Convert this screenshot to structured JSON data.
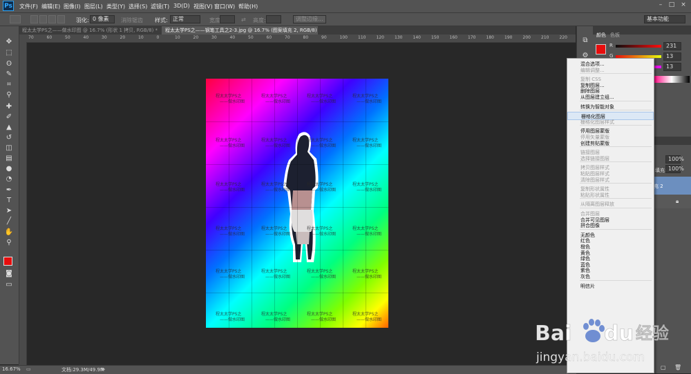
{
  "app": {
    "logo": "Ps"
  },
  "menu": [
    "文件(F)",
    "编辑(E)",
    "图像(I)",
    "图层(L)",
    "类型(Y)",
    "选择(S)",
    "滤镜(T)",
    "3D(D)",
    "视图(V)",
    "窗口(W)",
    "帮助(H)"
  ],
  "window_controls": [
    "–",
    "□",
    "×"
  ],
  "options": {
    "feather_label": "羽化:",
    "feather_value": "0 像素",
    "antialias": "消除锯齿",
    "style_label": "样式:",
    "style_value": "正常",
    "width_label": "宽度:",
    "height_label": "高度:",
    "refine_edge": "调整边缘...",
    "workspace": "基本功能"
  },
  "tabs": [
    {
      "label": "程太太学PS之——做水印图 @ 16.7% (形状 1 拷贝, RGB/8) *",
      "active": false
    },
    {
      "label": "程太太学PS之——钢笔工具之2-3.jpg @ 16.7% (图案填充 2, RGB/8) *",
      "active": true
    }
  ],
  "ruler_numbers": [
    "70",
    "60",
    "50",
    "40",
    "30",
    "20",
    "10",
    "0",
    "10",
    "20",
    "30",
    "40",
    "50",
    "60",
    "70",
    "80",
    "90",
    "100",
    "110",
    "120",
    "130",
    "140",
    "150",
    "160",
    "170",
    "180",
    "190",
    "200",
    "210",
    "220"
  ],
  "watermark": {
    "line1": "程太太学PS之",
    "line2": "——做水印图"
  },
  "status": {
    "zoom": "16.67%",
    "doc": "文档:29.3M/49.9M"
  },
  "color_panel": {
    "tabs": [
      "颜色",
      "色板"
    ],
    "r_label": "R",
    "g_label": "G",
    "b_label": "B",
    "r": "231",
    "g": "13",
    "b": "13"
  },
  "layers_panel": {
    "opacity_value": "100%",
    "fill_label": "填充:",
    "fill_value": "100%",
    "layer_name": "充 2"
  },
  "context_menu": [
    {
      "label": "混合选项...",
      "enabled": true
    },
    {
      "label": "编辑调整...",
      "enabled": false
    },
    {
      "sep": true
    },
    {
      "label": "复制 CSS",
      "enabled": false
    },
    {
      "label": "复制图层...",
      "enabled": true
    },
    {
      "label": "删除图层",
      "enabled": true
    },
    {
      "label": "从图层建立组...",
      "enabled": true
    },
    {
      "sep": true
    },
    {
      "label": "转换为智能对象",
      "enabled": true
    },
    {
      "sep": true
    },
    {
      "label": "栅格化图层",
      "enabled": true,
      "highlight": true
    },
    {
      "label": "栅格化图层样式",
      "enabled": false
    },
    {
      "sep": true
    },
    {
      "label": "停用图层蒙版",
      "enabled": true
    },
    {
      "label": "停用矢量蒙版",
      "enabled": false
    },
    {
      "label": "创建剪贴蒙版",
      "enabled": true
    },
    {
      "sep": true
    },
    {
      "label": "链接图层",
      "enabled": false
    },
    {
      "label": "选择链接图层",
      "enabled": false
    },
    {
      "sep": true
    },
    {
      "label": "拷贝图层样式",
      "enabled": false
    },
    {
      "label": "粘贴图层样式",
      "enabled": false
    },
    {
      "label": "清除图层样式",
      "enabled": false
    },
    {
      "sep": true
    },
    {
      "label": "复制形状属性",
      "enabled": false
    },
    {
      "label": "粘贴形状属性",
      "enabled": false
    },
    {
      "sep": true
    },
    {
      "label": "从隔离图层释放",
      "enabled": false
    },
    {
      "sep": true
    },
    {
      "label": "合并图层",
      "enabled": false
    },
    {
      "label": "合并可见图层",
      "enabled": true
    },
    {
      "label": "拼合图像",
      "enabled": true
    },
    {
      "sep": true
    },
    {
      "label": "无颜色",
      "enabled": true
    },
    {
      "label": "红色",
      "enabled": true
    },
    {
      "label": "橙色",
      "enabled": true
    },
    {
      "label": "黄色",
      "enabled": true
    },
    {
      "label": "绿色",
      "enabled": true
    },
    {
      "label": "蓝色",
      "enabled": true
    },
    {
      "label": "紫色",
      "enabled": true
    },
    {
      "label": "灰色",
      "enabled": true
    },
    {
      "sep": true
    },
    {
      "label": "明信片",
      "enabled": true
    }
  ],
  "baidu": {
    "brand": "Bai",
    "du": "du",
    "jingyan": "经验",
    "url": "jingyan.baidu.com"
  },
  "colors": {
    "accent": "#31a8ff",
    "foreground": "#e70d0d",
    "bg": "#282828"
  }
}
